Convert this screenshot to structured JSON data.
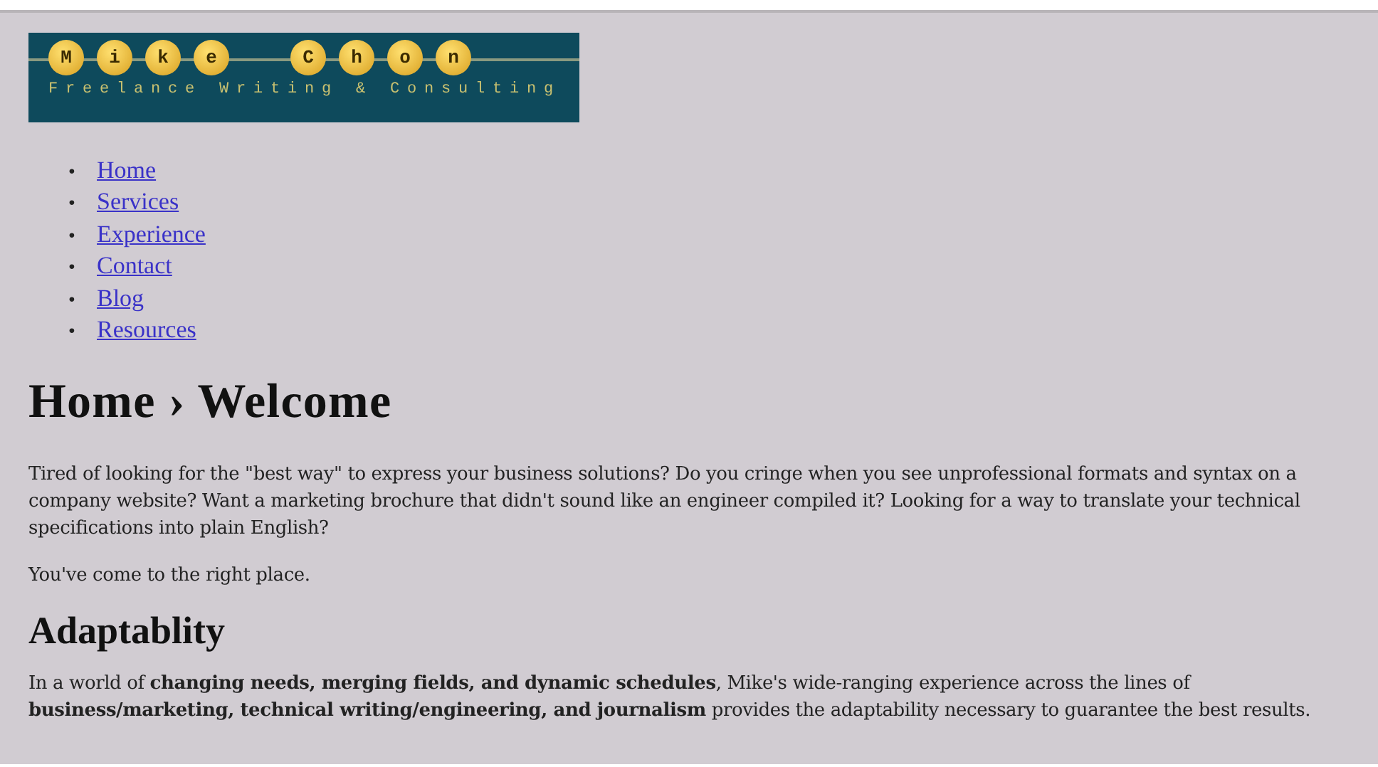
{
  "logo": {
    "words": [
      [
        "M",
        "i",
        "k",
        "e"
      ],
      [
        "C",
        "h",
        "o",
        "n"
      ]
    ],
    "tagline": "Freelance Writing & Consulting"
  },
  "nav": [
    {
      "bullet": "•",
      "label": "Home"
    },
    {
      "bullet": "•",
      "label": "Services"
    },
    {
      "bullet": "•",
      "label": "Experience"
    },
    {
      "bullet": "•",
      "label": "Contact"
    },
    {
      "bullet": "•",
      "label": "Blog"
    },
    {
      "bullet": "•",
      "label": "Resources"
    }
  ],
  "heading": "Home › Welcome",
  "intro": [
    "Tired of looking for the \"best way\" to express your business solutions? Do you cringe when you see unprofessional formats and syntax on a company website? Want a marketing brochure that didn't sound like an engineer compiled it? Looking for a way to translate your technical specifications into plain English?",
    "You've come to the right place."
  ],
  "section": {
    "heading": "Adaptablity",
    "text": "In a world of **changing needs, merging fields, and dynamic schedules**, Mike's wide-ranging experience across the lines of **business/marketing, technical writing/engineering, and journalism** provides the adaptability necessary to guarantee the best results."
  }
}
